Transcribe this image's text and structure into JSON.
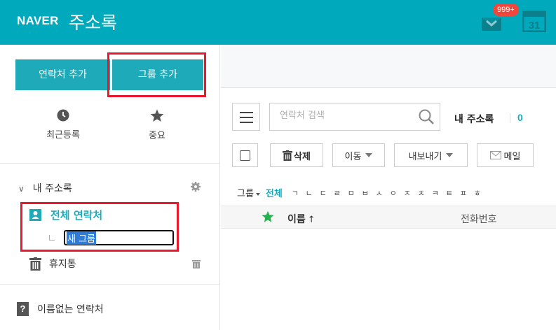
{
  "header": {
    "logo": "NAVER",
    "title": "주소록",
    "mail_badge": "999+",
    "calendar_day": "31"
  },
  "sidebar": {
    "add_contact_label": "연락처 추가",
    "add_group_label": "그룹 추가",
    "recent_label": "최근등록",
    "important_label": "중요",
    "my_book_label": "내 주소록",
    "all_contacts_label": "전체 연락처",
    "new_group_value": "새 그룹",
    "trash_label": "휴지통",
    "unnamed_label": "이름없는 연락처"
  },
  "main": {
    "search_placeholder": "연락처 검색",
    "my_book_label": "내 주소록",
    "my_book_count": "0",
    "toolbar": {
      "delete_label": "삭제",
      "move_label": "이동",
      "export_label": "내보내기",
      "mail_label": "메일"
    },
    "filter": {
      "group_label": "그룹",
      "all_label": "전체",
      "letters": [
        "ㄱ",
        "ㄴ",
        "ㄷ",
        "ㄹ",
        "ㅁ",
        "ㅂ",
        "ㅅ",
        "ㅇ",
        "ㅈ",
        "ㅊ",
        "ㅋ",
        "ㅌ",
        "ㅍ",
        "ㅎ"
      ]
    },
    "columns": {
      "name_label": "이름",
      "sort_arrow": "↑",
      "phone_label": "전화번호"
    }
  },
  "colors": {
    "brand": "#00a9bc",
    "accent": "#1eaab8",
    "highlight_box": "#e8192c",
    "badge": "#f0463c",
    "star": "#22b14c"
  }
}
